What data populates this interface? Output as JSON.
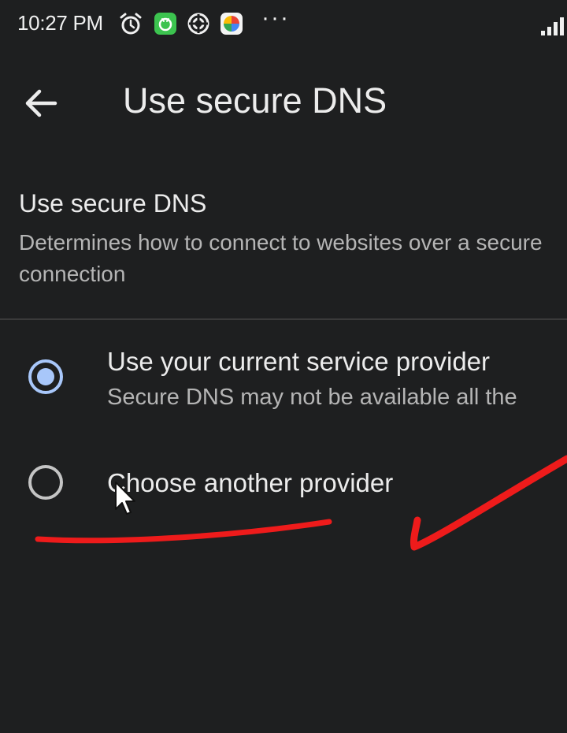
{
  "status_bar": {
    "time": "10:27 PM",
    "more": "···",
    "icons": [
      "alarm-icon",
      "app-green-icon",
      "app-spiral-icon",
      "app-photos-icon",
      "signal-icon"
    ]
  },
  "toolbar": {
    "back_icon": "arrow-left-icon",
    "title": "Use secure DNS"
  },
  "section": {
    "title": "Use secure DNS",
    "description": "Determines how to connect to websites over a secure connection"
  },
  "options": [
    {
      "label": "Use your current service provider",
      "sublabel": "Secure DNS may not be available all the",
      "selected": true
    },
    {
      "label": "Choose another provider",
      "selected": false
    }
  ],
  "colors": {
    "background": "#1e1f20",
    "accent": "#a8c7fa",
    "annotation": "#ee1b1b"
  }
}
